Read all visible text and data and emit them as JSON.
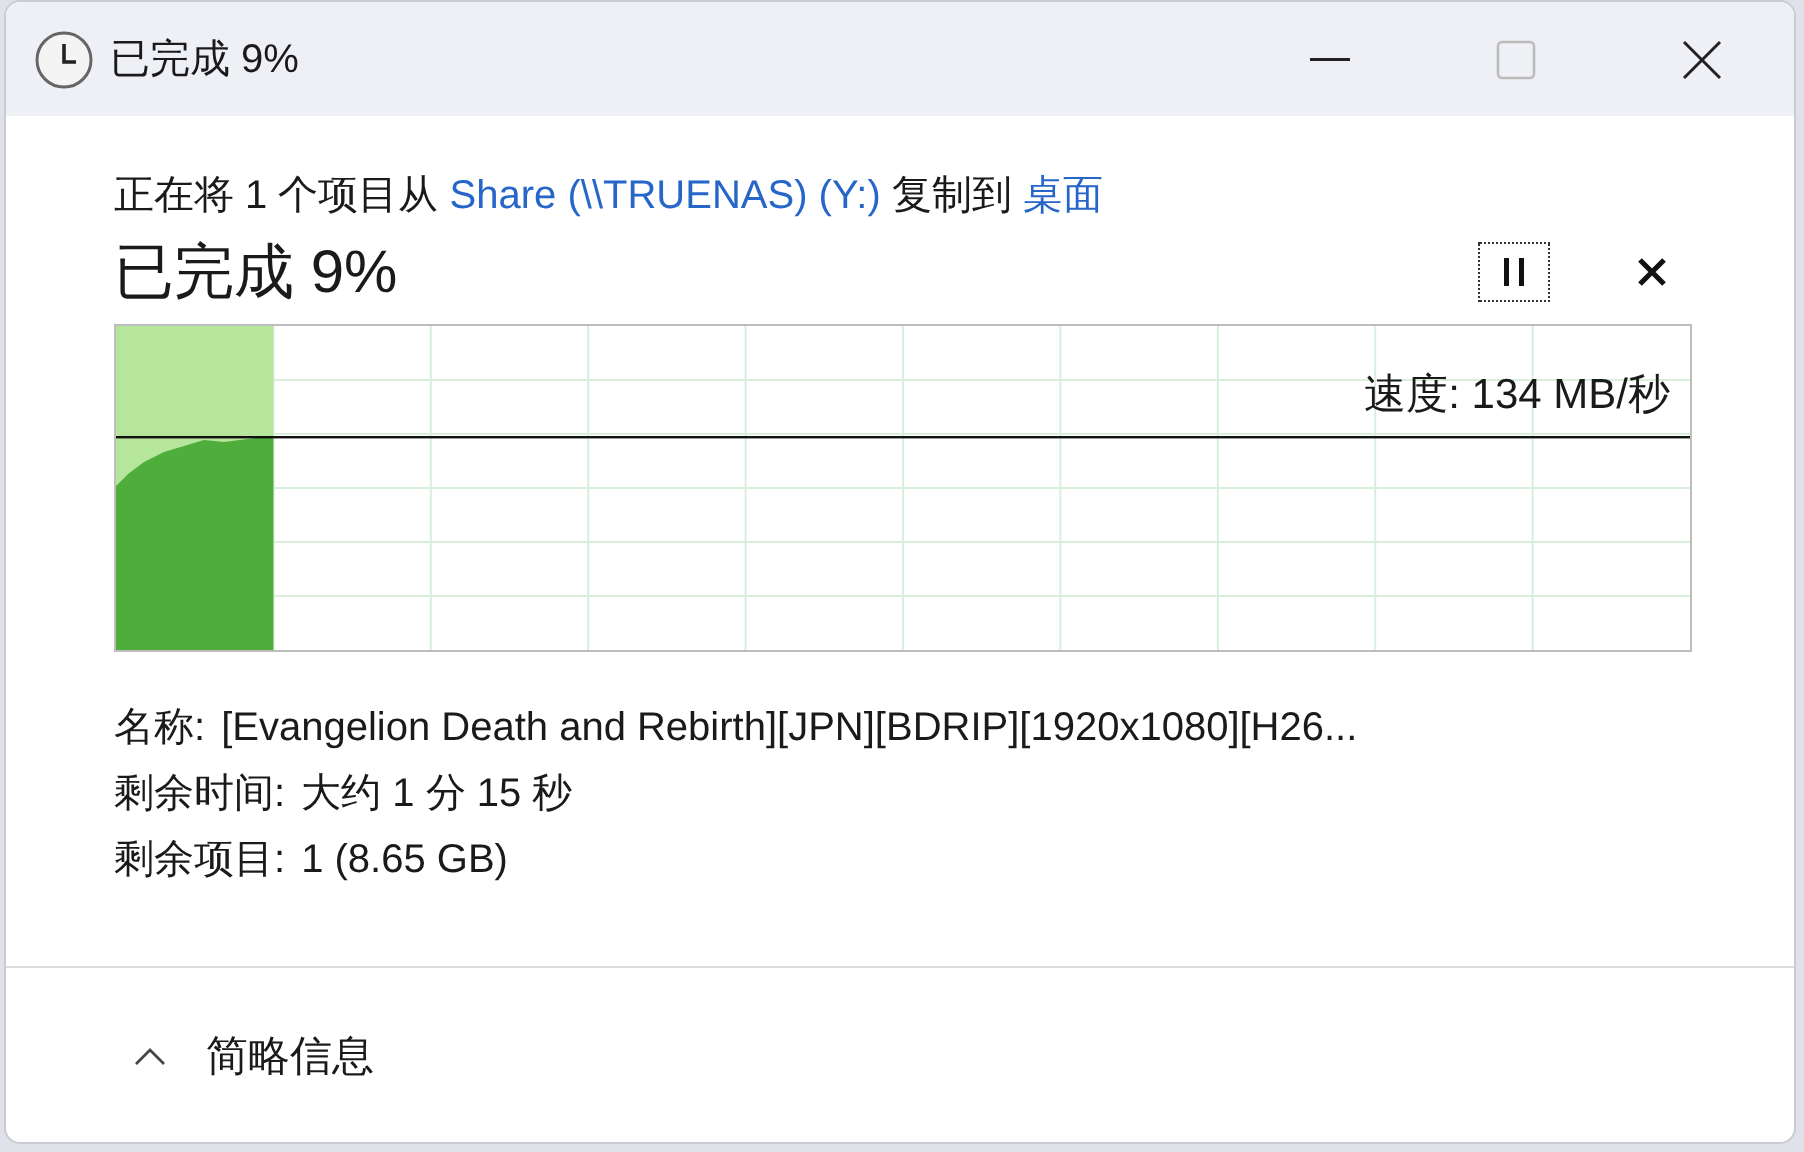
{
  "window": {
    "title": "已完成 9%",
    "maximize_disabled": true
  },
  "copy_message": {
    "parts": [
      {
        "kind": "text",
        "text": "正在将 1 个项目从 "
      },
      {
        "kind": "link",
        "text": "Share (\\\\TRUENAS) (Y:)"
      },
      {
        "kind": "text",
        "text": " 复制到 "
      },
      {
        "kind": "link",
        "text": "桌面"
      }
    ]
  },
  "progress": {
    "heading": "已完成 9%",
    "level": 0.1,
    "speed": "速度: 134 MB/秒"
  },
  "details": [
    {
      "label": "名称:",
      "value": "[Evangelion Death and Rebirth][JPN][BDRIP][1920x1080][H26..."
    },
    {
      "label": "剩余时间:",
      "value": "大约 1 分 15 秒"
    },
    {
      "label": "剩余项目:",
      "value": "1 (8.65 GB)"
    }
  ],
  "footer": {
    "label": "简略信息",
    "expanded": true
  }
}
